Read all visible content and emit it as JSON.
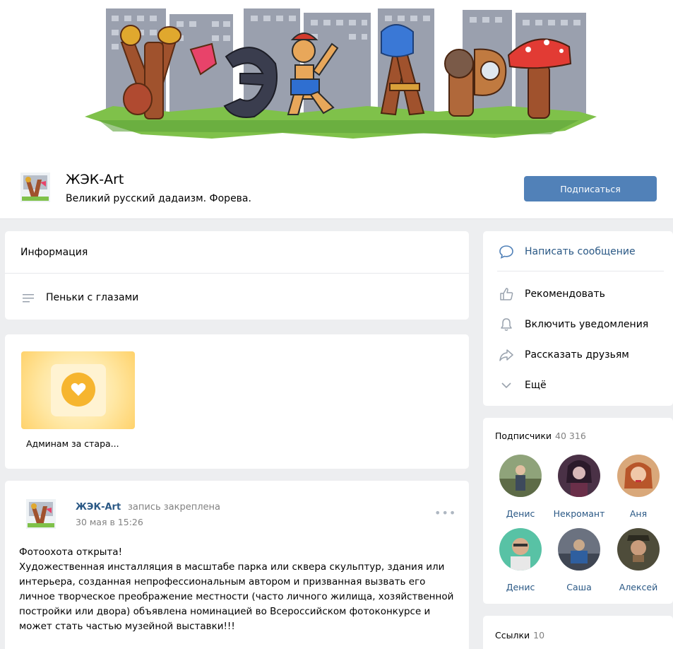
{
  "header": {
    "title": "ЖЭК-Art",
    "status": "Великий русский дадаизм. Форева.",
    "subscribe_label": "Подписаться"
  },
  "info": {
    "heading": "Информация",
    "description": "Пеньки с глазами"
  },
  "album": {
    "title": "Админам за стара..."
  },
  "actions": [
    {
      "label": "Написать сообщение",
      "icon": "message-bubble-icon"
    },
    {
      "label": "Рекомендовать",
      "icon": "thumbs-up-icon"
    },
    {
      "label": "Включить уведомления",
      "icon": "bell-icon"
    },
    {
      "label": "Рассказать друзьям",
      "icon": "share-arrow-icon"
    },
    {
      "label": "Ещё",
      "icon": "chevron-down-icon"
    }
  ],
  "subscribers": {
    "heading": "Подписчики",
    "count": "40 316",
    "items": [
      {
        "name": "Денис"
      },
      {
        "name": "Некромант"
      },
      {
        "name": "Аня"
      },
      {
        "name": "Денис"
      },
      {
        "name": "Саша"
      },
      {
        "name": "Алексей"
      }
    ]
  },
  "links": {
    "heading": "Ссылки",
    "count": "10"
  },
  "post": {
    "author": "ЖЭК-Art",
    "pinned_label": "запись закреплена",
    "date": "30 мая в 15:26",
    "more": "•••",
    "text": "Фотоохота открыта!\nХудожественная инсталляция в масштабе парка или сквера скульптур, здания или интерьера, созданная непрофессиональным автором и призванная вызвать его личное творческое преображение местности (часто личного жилища, хозяйственной постройки или двора) объявлена номинацией во Всероссийском фотоконкурсе и может стать частью музейной выставки!!!"
  },
  "colors": {
    "accent": "#5181b8",
    "link": "#2a5885",
    "page_bg": "#edeef0",
    "muted": "#828282"
  }
}
